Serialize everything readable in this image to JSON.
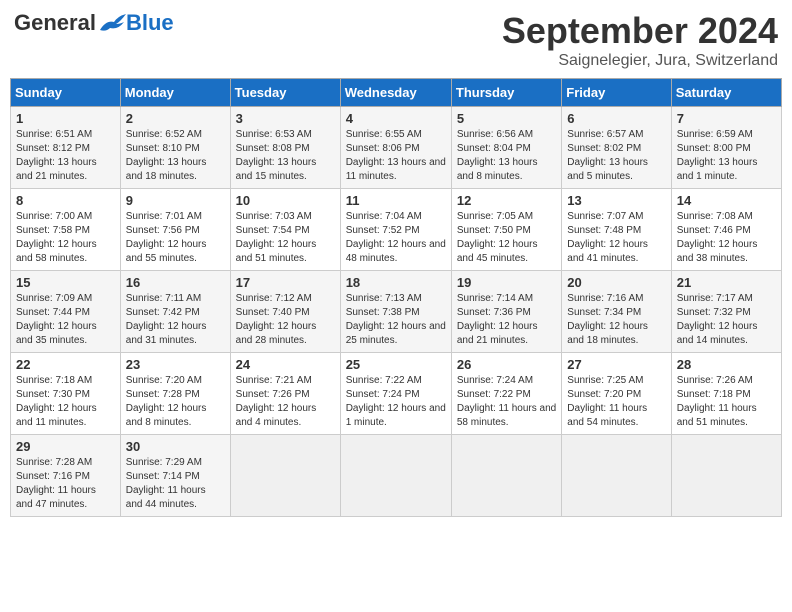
{
  "header": {
    "logo_general": "General",
    "logo_blue": "Blue",
    "title": "September 2024",
    "subtitle": "Saignelegier, Jura, Switzerland"
  },
  "weekdays": [
    "Sunday",
    "Monday",
    "Tuesday",
    "Wednesday",
    "Thursday",
    "Friday",
    "Saturday"
  ],
  "weeks": [
    [
      {
        "day": "1",
        "sunrise": "6:51 AM",
        "sunset": "8:12 PM",
        "daylight": "13 hours and 21 minutes."
      },
      {
        "day": "2",
        "sunrise": "6:52 AM",
        "sunset": "8:10 PM",
        "daylight": "13 hours and 18 minutes."
      },
      {
        "day": "3",
        "sunrise": "6:53 AM",
        "sunset": "8:08 PM",
        "daylight": "13 hours and 15 minutes."
      },
      {
        "day": "4",
        "sunrise": "6:55 AM",
        "sunset": "8:06 PM",
        "daylight": "13 hours and 11 minutes."
      },
      {
        "day": "5",
        "sunrise": "6:56 AM",
        "sunset": "8:04 PM",
        "daylight": "13 hours and 8 minutes."
      },
      {
        "day": "6",
        "sunrise": "6:57 AM",
        "sunset": "8:02 PM",
        "daylight": "13 hours and 5 minutes."
      },
      {
        "day": "7",
        "sunrise": "6:59 AM",
        "sunset": "8:00 PM",
        "daylight": "13 hours and 1 minute."
      }
    ],
    [
      {
        "day": "8",
        "sunrise": "7:00 AM",
        "sunset": "7:58 PM",
        "daylight": "12 hours and 58 minutes."
      },
      {
        "day": "9",
        "sunrise": "7:01 AM",
        "sunset": "7:56 PM",
        "daylight": "12 hours and 55 minutes."
      },
      {
        "day": "10",
        "sunrise": "7:03 AM",
        "sunset": "7:54 PM",
        "daylight": "12 hours and 51 minutes."
      },
      {
        "day": "11",
        "sunrise": "7:04 AM",
        "sunset": "7:52 PM",
        "daylight": "12 hours and 48 minutes."
      },
      {
        "day": "12",
        "sunrise": "7:05 AM",
        "sunset": "7:50 PM",
        "daylight": "12 hours and 45 minutes."
      },
      {
        "day": "13",
        "sunrise": "7:07 AM",
        "sunset": "7:48 PM",
        "daylight": "12 hours and 41 minutes."
      },
      {
        "day": "14",
        "sunrise": "7:08 AM",
        "sunset": "7:46 PM",
        "daylight": "12 hours and 38 minutes."
      }
    ],
    [
      {
        "day": "15",
        "sunrise": "7:09 AM",
        "sunset": "7:44 PM",
        "daylight": "12 hours and 35 minutes."
      },
      {
        "day": "16",
        "sunrise": "7:11 AM",
        "sunset": "7:42 PM",
        "daylight": "12 hours and 31 minutes."
      },
      {
        "day": "17",
        "sunrise": "7:12 AM",
        "sunset": "7:40 PM",
        "daylight": "12 hours and 28 minutes."
      },
      {
        "day": "18",
        "sunrise": "7:13 AM",
        "sunset": "7:38 PM",
        "daylight": "12 hours and 25 minutes."
      },
      {
        "day": "19",
        "sunrise": "7:14 AM",
        "sunset": "7:36 PM",
        "daylight": "12 hours and 21 minutes."
      },
      {
        "day": "20",
        "sunrise": "7:16 AM",
        "sunset": "7:34 PM",
        "daylight": "12 hours and 18 minutes."
      },
      {
        "day": "21",
        "sunrise": "7:17 AM",
        "sunset": "7:32 PM",
        "daylight": "12 hours and 14 minutes."
      }
    ],
    [
      {
        "day": "22",
        "sunrise": "7:18 AM",
        "sunset": "7:30 PM",
        "daylight": "12 hours and 11 minutes."
      },
      {
        "day": "23",
        "sunrise": "7:20 AM",
        "sunset": "7:28 PM",
        "daylight": "12 hours and 8 minutes."
      },
      {
        "day": "24",
        "sunrise": "7:21 AM",
        "sunset": "7:26 PM",
        "daylight": "12 hours and 4 minutes."
      },
      {
        "day": "25",
        "sunrise": "7:22 AM",
        "sunset": "7:24 PM",
        "daylight": "12 hours and 1 minute."
      },
      {
        "day": "26",
        "sunrise": "7:24 AM",
        "sunset": "7:22 PM",
        "daylight": "11 hours and 58 minutes."
      },
      {
        "day": "27",
        "sunrise": "7:25 AM",
        "sunset": "7:20 PM",
        "daylight": "11 hours and 54 minutes."
      },
      {
        "day": "28",
        "sunrise": "7:26 AM",
        "sunset": "7:18 PM",
        "daylight": "11 hours and 51 minutes."
      }
    ],
    [
      {
        "day": "29",
        "sunrise": "7:28 AM",
        "sunset": "7:16 PM",
        "daylight": "11 hours and 47 minutes."
      },
      {
        "day": "30",
        "sunrise": "7:29 AM",
        "sunset": "7:14 PM",
        "daylight": "11 hours and 44 minutes."
      },
      null,
      null,
      null,
      null,
      null
    ]
  ]
}
